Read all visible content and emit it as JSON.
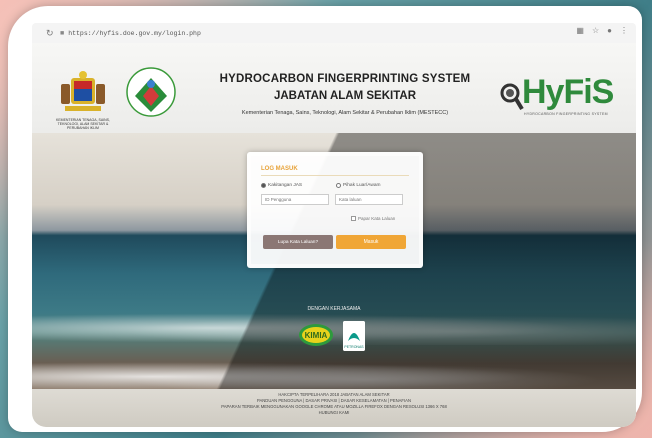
{
  "browser": {
    "url": "https://hyfis.doe.gov.my/login.php",
    "nav_back_icon": "back-arrow-icon",
    "nav_reload_icon": "reload-icon"
  },
  "header": {
    "title_line1": "HYDROCARBON FINGERPRINTING SYSTEM",
    "title_line2": "JABATAN ALAM SEKITAR",
    "subtitle": "Kementerian Tenaga, Sains, Teknologi, Alam Sekitar & Perubahan Iklim (MESTECC)",
    "brand": "HyFiS",
    "brand_tagline": "HYDROCARBON FINGERPRINTING SYSTEM",
    "brand_color": "#2f8a3c",
    "crest_caption": "KEMENTERIAN TENAGA, SAINS, TEKNOLOGI, ALAM SEKITAR & PERUBAHAN IKLIM"
  },
  "login": {
    "title": "LOG MASUK",
    "radio_option_1": "Kakitangan JAS",
    "radio_option_2": "Pihak Luar/Awam",
    "username_placeholder": "ID Pengguna",
    "password_placeholder": "Kata laluan",
    "show_password": "Papar Kata Laluan",
    "forgot_button": "Lupa Kata Laluan?",
    "login_button": "Masuk",
    "accent_color": "#f0a636"
  },
  "partners": {
    "label": "DENGAN KERJASAMA",
    "partner_1": "KIMIA",
    "partner_2": "PETRONAS"
  },
  "footer": {
    "line1": "HAKCIPTA TERPELIHARA 2018 JABATAN ALAM SEKITAR",
    "line2": "PANDUAN PENGGUNA | DASAR PRIVASI | DASAR KESELAMATAN | PENAFIAN",
    "line3": "PAPARAN TERBAIK MENGGUNAKAN GOOGLE CHROME ATAU MOZILLA FIREFOX DENGAN RESOLUSI 1366 X 768",
    "line4": "HUBUNGI KAMI"
  }
}
